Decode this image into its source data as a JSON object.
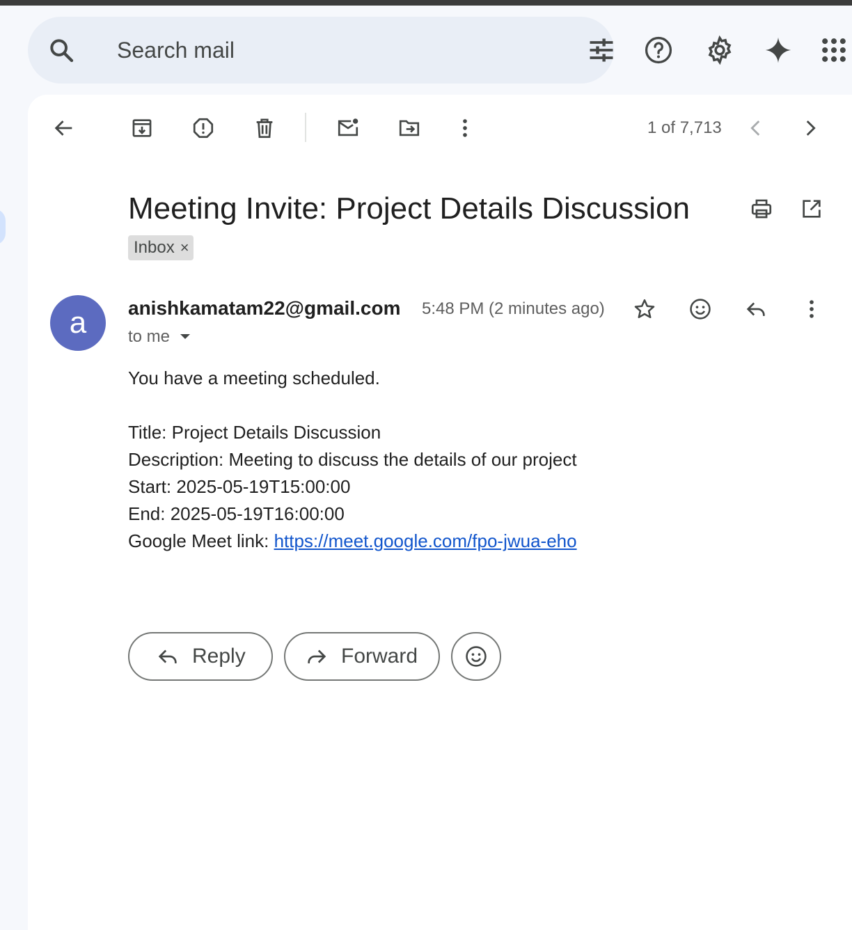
{
  "search": {
    "placeholder": "Search mail"
  },
  "toolbar": {
    "counter": "1 of 7,713"
  },
  "email": {
    "subject": "Meeting Invite: Project Details Discussion",
    "label": "Inbox",
    "label_remove": "×",
    "avatar_letter": "a",
    "sender": "anishkamatam22@gmail.com",
    "time": "5:48 PM (2 minutes ago)",
    "recipient": "to me",
    "body": {
      "intro": "You have a meeting scheduled.",
      "title_line": "Title: Project Details Discussion",
      "description_line": "Description: Meeting to discuss the details of our project",
      "start_line": "Start: 2025-05-19T15:00:00",
      "end_line": "End: 2025-05-19T16:00:00",
      "meet_label": "Google Meet link: ",
      "meet_url": "https://meet.google.com/fpo-jwua-eho"
    }
  },
  "actions": {
    "reply_label": "Reply",
    "forward_label": "Forward"
  },
  "colors": {
    "avatar_bg": "#5c6bc0",
    "link": "#1155cc",
    "page_bg": "#f6f8fc",
    "search_bg": "#e9eef6"
  }
}
